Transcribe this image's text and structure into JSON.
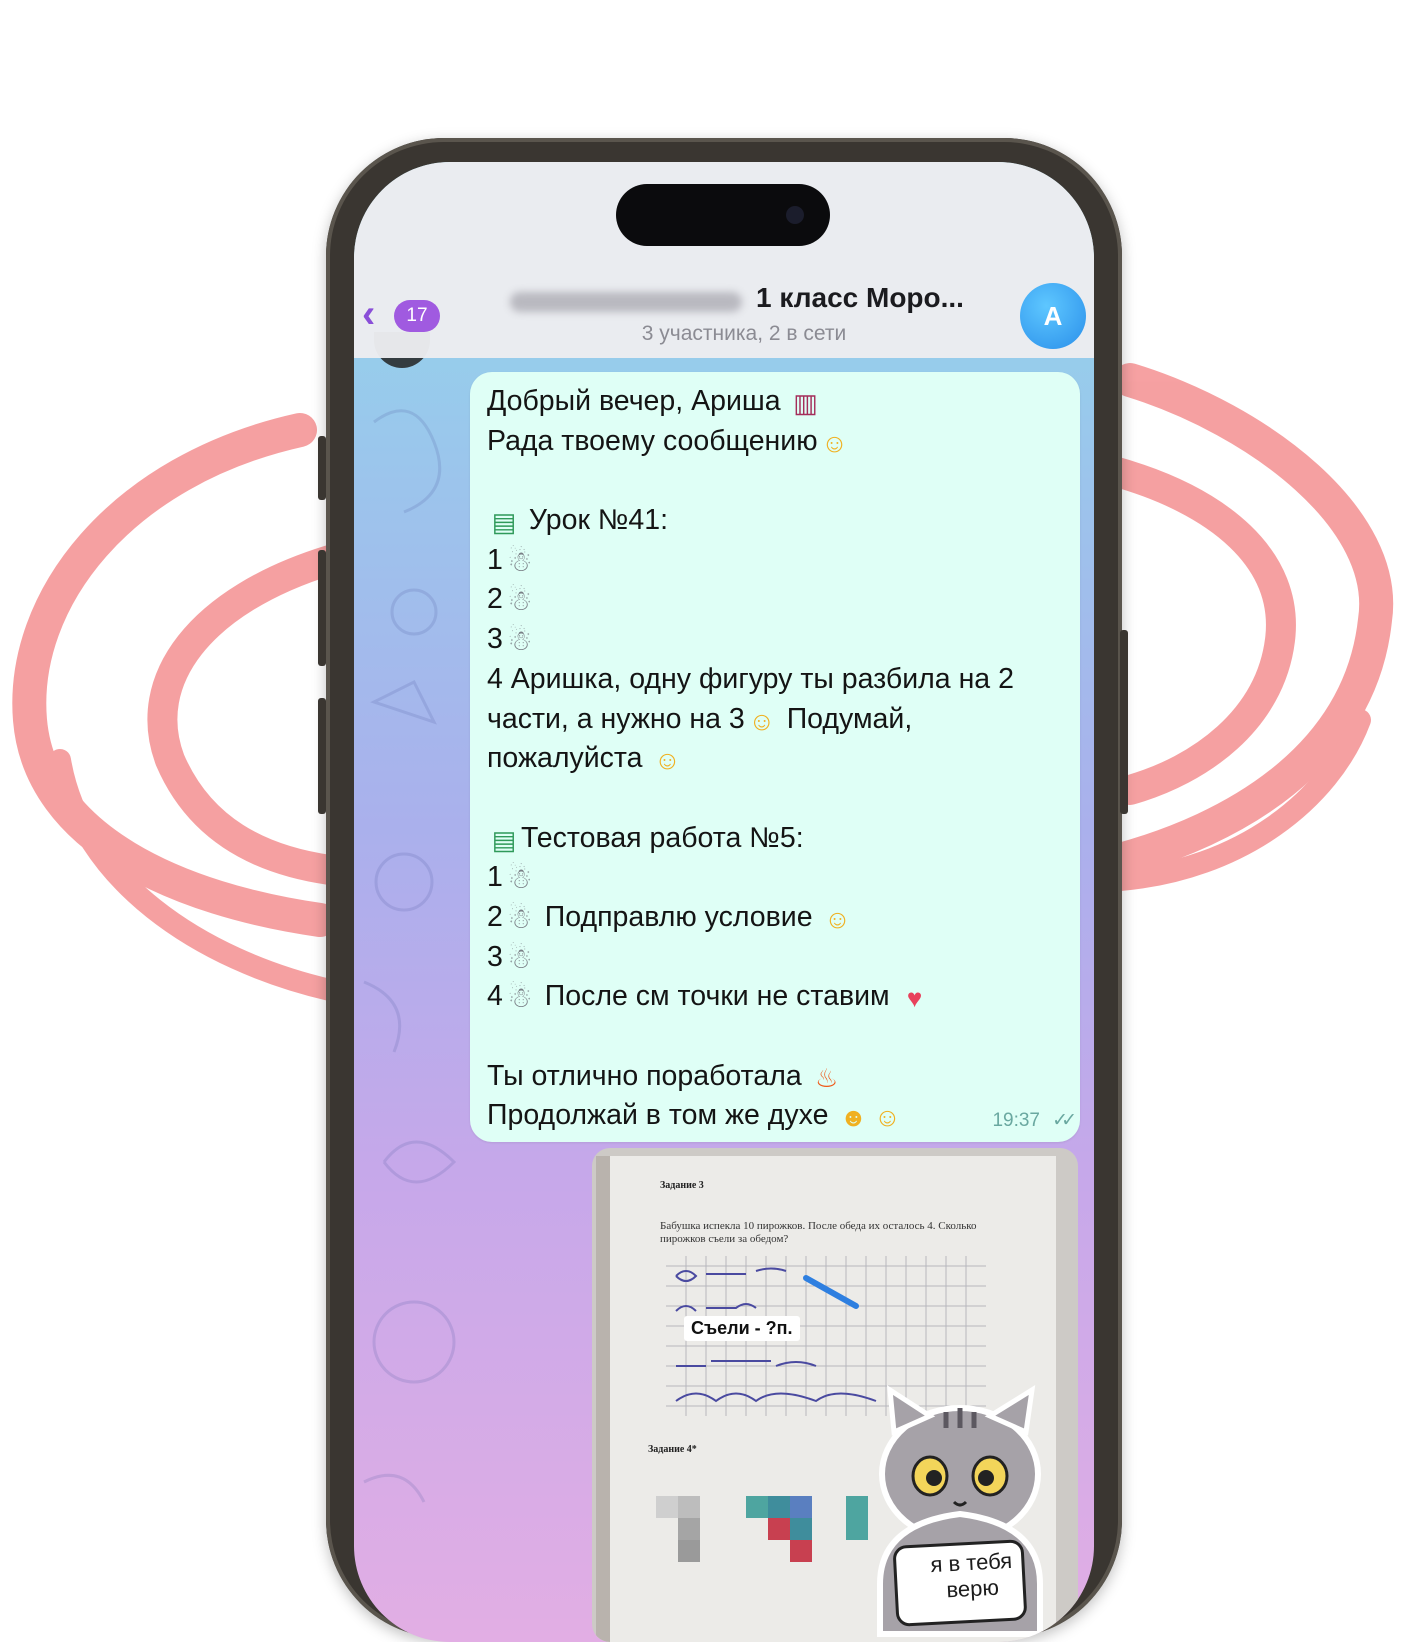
{
  "header": {
    "back_badge": "17",
    "chat_title": "1 класс Моро...",
    "chat_subtitle": "3 участника, 2 в сети",
    "avatar_letter": "А"
  },
  "message": {
    "time": "19:37",
    "lines": [
      {
        "text": "Добрый вечер, Ариша ",
        "emoji": "city-sunset"
      },
      {
        "text": "Рада твоему сообщению",
        "emoji": "hugging-face"
      },
      {
        "text": "",
        "emoji": ""
      },
      {
        "prefix_emoji": "books",
        "text": " Урок №41:"
      },
      {
        "text": "1",
        "emoji": "snowman"
      },
      {
        "text": "2",
        "emoji": "snowman"
      },
      {
        "text": "3",
        "emoji": "snowman"
      },
      {
        "text": "4 Аришка, одну фигуру ты разбила на 2"
      },
      {
        "text": "части, а нужно на 3",
        "emoji": "hugging-face",
        "after": " Подумай,"
      },
      {
        "text": "пожалуйста ",
        "emoji": "smiling-face"
      },
      {
        "text": "",
        "emoji": ""
      },
      {
        "prefix_emoji": "books",
        "text": "Тестовая работа №5:"
      },
      {
        "text": "1",
        "emoji": "snowman"
      },
      {
        "text": "2",
        "emoji": "snowman",
        "after": " Подправлю условие ",
        "emoji2": "hugging-face"
      },
      {
        "text": "3",
        "emoji": "snowman"
      },
      {
        "text": "4",
        "emoji": "snowman",
        "after": " После см точки не ставим ",
        "emoji2": "smiling-face-with-hearts"
      },
      {
        "text": "",
        "emoji": ""
      },
      {
        "text": "Ты отлично поработала ",
        "emoji": "fire"
      },
      {
        "text": "Продолжай в том же духе ",
        "emoji": "partying-face",
        "emoji2": "hugging-face"
      }
    ]
  },
  "photo": {
    "caption": "Съели - ?п.",
    "sticker_text": "я в тебя верю",
    "worksheet_heading": "Задание 3",
    "worksheet_task": "Бабушка испекла 10 пирожков. После обеда их осталось 4. Сколько пирожков съели за обедом?",
    "worksheet_heading_2": "Задание 4*"
  },
  "colors": {
    "accent": "#a05ae0",
    "bubble": "#dffff6",
    "swirl": "#f5999a",
    "frame": "#3a3631"
  }
}
